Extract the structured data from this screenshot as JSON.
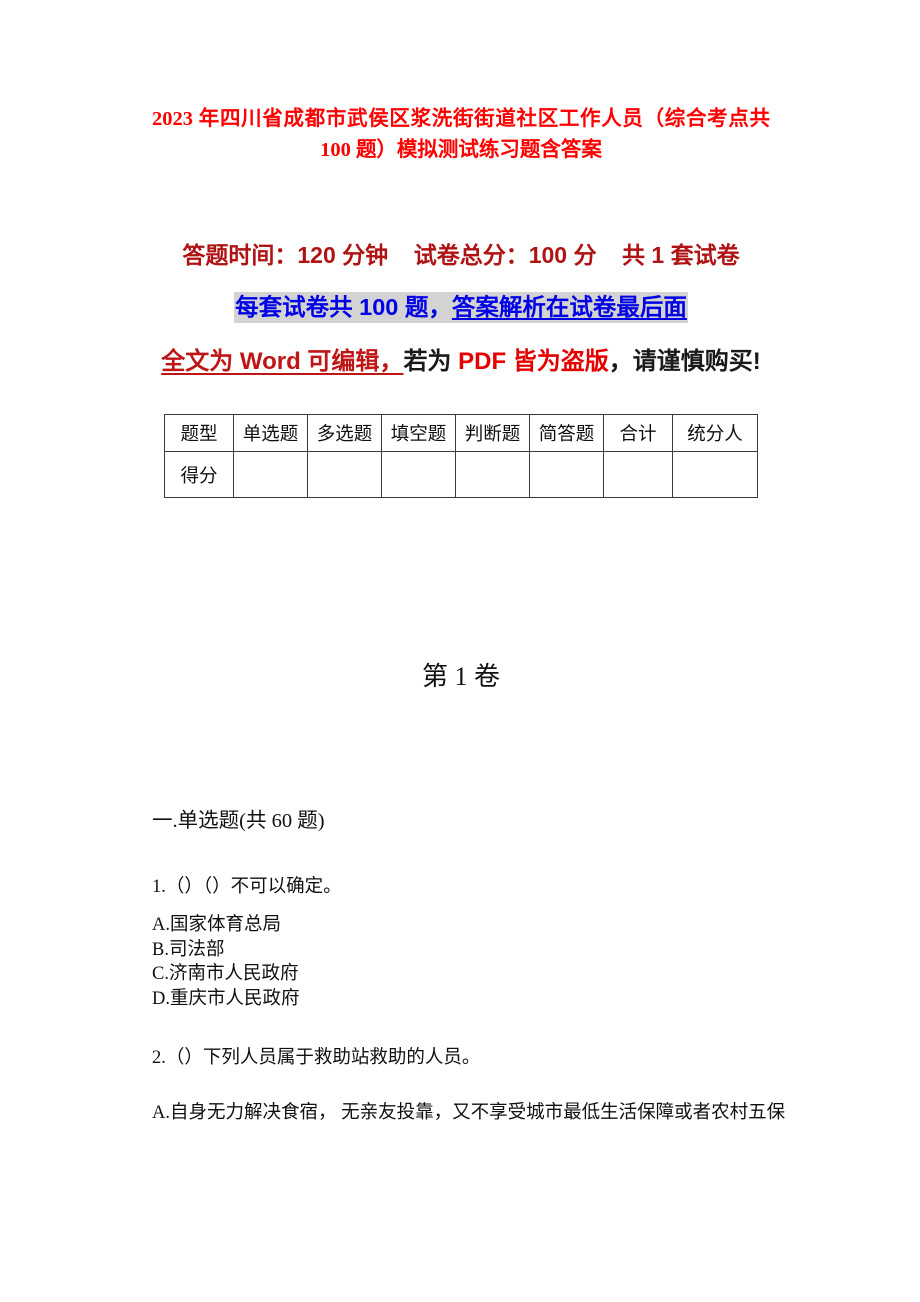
{
  "document": {
    "title": "2023 年四川省成都市武侯区浆洗街街道社区工作人员（综合考点共 100 题）模拟测试练习题含答案",
    "title_color": "#ff0000"
  },
  "banner": {
    "line1": "答题时间：120 分钟    试卷总分：100 分    共 1 套试卷",
    "line1_color": "#b01313",
    "line2_part1": "每套试卷共 100 题，",
    "line2_part2": "答案解析在试卷最后面",
    "line2_color": "#0000e6",
    "line2_highlight": "#d3d3d3",
    "line3_part1": "全文为 Word 可编辑，",
    "line3_part2": "若为 ",
    "line3_part3": "PDF 皆为盗版",
    "line3_part4": "，请谨慎购买!",
    "line3_color_dark_red": "#c01515",
    "line3_color_bright_red": "#e50000"
  },
  "score_table": {
    "headers": [
      "题型",
      "单选题",
      "多选题",
      "填空题",
      "判断题",
      "简答题",
      "合计",
      "统分人"
    ],
    "row_label": "得分",
    "row_values": [
      "",
      "",
      "",
      "",
      "",
      "",
      ""
    ]
  },
  "volume": {
    "label": "第 1 卷"
  },
  "section": {
    "heading": "一.单选题(共 60 题)"
  },
  "questions": [
    {
      "number": "1.",
      "text": "1.（）（）不可以确定。",
      "options": [
        "A.国家体育总局",
        "B.司法部",
        "C.济南市人民政府",
        "D.重庆市人民政府"
      ]
    },
    {
      "number": "2.",
      "text": "2.（）下列人员属于救助站救助的人员。",
      "options": [
        "A.自身无力解决食宿， 无亲友投靠，又不享受城市最低生活保障或者农村五保"
      ]
    }
  ]
}
